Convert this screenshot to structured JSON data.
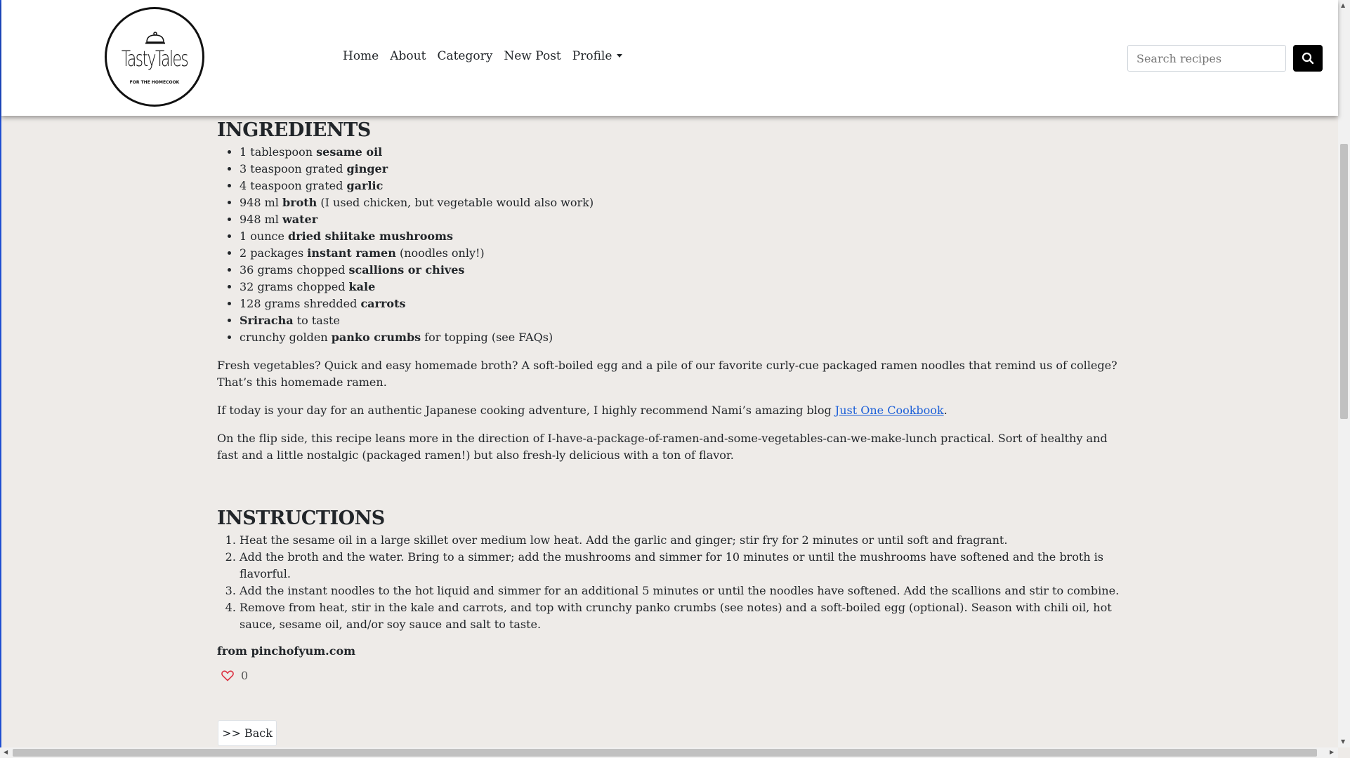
{
  "brand": {
    "name": "TastyTales",
    "tagline": "FOR THE HOMECOOK",
    "logo_icon": "cloche-icon"
  },
  "nav": {
    "home": "Home",
    "about": "About",
    "category": "Category",
    "new_post": "New Post",
    "profile": "Profile"
  },
  "search": {
    "placeholder": "Search recipes",
    "button_icon": "search-icon"
  },
  "ingredients": {
    "title": "INGREDIENTS",
    "items": [
      {
        "pre": "1 tablespoon ",
        "bold": "sesame oil",
        "post": ""
      },
      {
        "pre": "3 teaspoon grated ",
        "bold": "ginger",
        "post": ""
      },
      {
        "pre": "4 teaspoon grated ",
        "bold": "garlic",
        "post": ""
      },
      {
        "pre": "948 ml ",
        "bold": "broth",
        "post": " (I used chicken, but vegetable would also work)"
      },
      {
        "pre": "948 ml ",
        "bold": "water",
        "post": ""
      },
      {
        "pre": "1 ounce ",
        "bold": "dried shiitake mushrooms",
        "post": ""
      },
      {
        "pre": "2 packages ",
        "bold": "instant ramen",
        "post": " (noodles only!)"
      },
      {
        "pre": "36 grams chopped ",
        "bold": "scallions or chives",
        "post": ""
      },
      {
        "pre": "32 grams chopped ",
        "bold": "kale",
        "post": ""
      },
      {
        "pre": "128 grams shredded ",
        "bold": "carrots",
        "post": ""
      },
      {
        "pre": "",
        "bold": "Sriracha",
        "post": " to taste"
      },
      {
        "pre": "crunchy golden ",
        "bold": "panko crumbs",
        "post": " for topping (see FAQs)"
      }
    ]
  },
  "description": {
    "p1": "Fresh vegetables? Quick and easy homemade broth? A soft-boiled egg and a pile of our favorite curly-cue packaged ramen noodles that remind us of college? That’s this homemade ramen.",
    "p2_pre": "If today is your day for an authentic Japanese cooking adventure, I highly recommend Nami’s amazing blog ",
    "p2_link": "Just One Cookbook",
    "p2_post": ".",
    "p3": "On the flip side, this recipe leans more in the direction of I-have-a-package-of-ramen-and-some-vegetables-can-we-make-lunch practical. Sort of healthy and fast and a little nostalgic (packaged ramen!) but also fresh-ly delicious with a ton of flavor."
  },
  "instructions": {
    "title": "INSTRUCTIONS",
    "steps": [
      "Heat the sesame oil in a large skillet over medium low heat. Add the garlic and ginger; stir fry for 2 minutes or until soft and fragrant.",
      "Add the broth and the water. Bring to a simmer; add the mushrooms and simmer for 10 minutes or until the mushrooms have softened and the broth is flavorful.",
      "Add the instant noodles to the hot liquid and simmer for an additional 5 minutes or until the noodles have softened. Add the scallions and stir to combine.",
      "Remove from heat, stir in the kale and carrots, and top with crunchy panko crumbs (see notes) and a soft-boiled egg (optional). Season with chili oil, hot sauce, sesame oil, and/or soy sauce and salt to taste."
    ]
  },
  "source": "from pinchofyum.com",
  "likes": {
    "count": "0",
    "icon": "heart-icon",
    "color": "#dc3545"
  },
  "back_label": ">> Back",
  "colors": {
    "link": "#1b5fd8",
    "background": "#eeebe8",
    "search_button": "#000000"
  }
}
